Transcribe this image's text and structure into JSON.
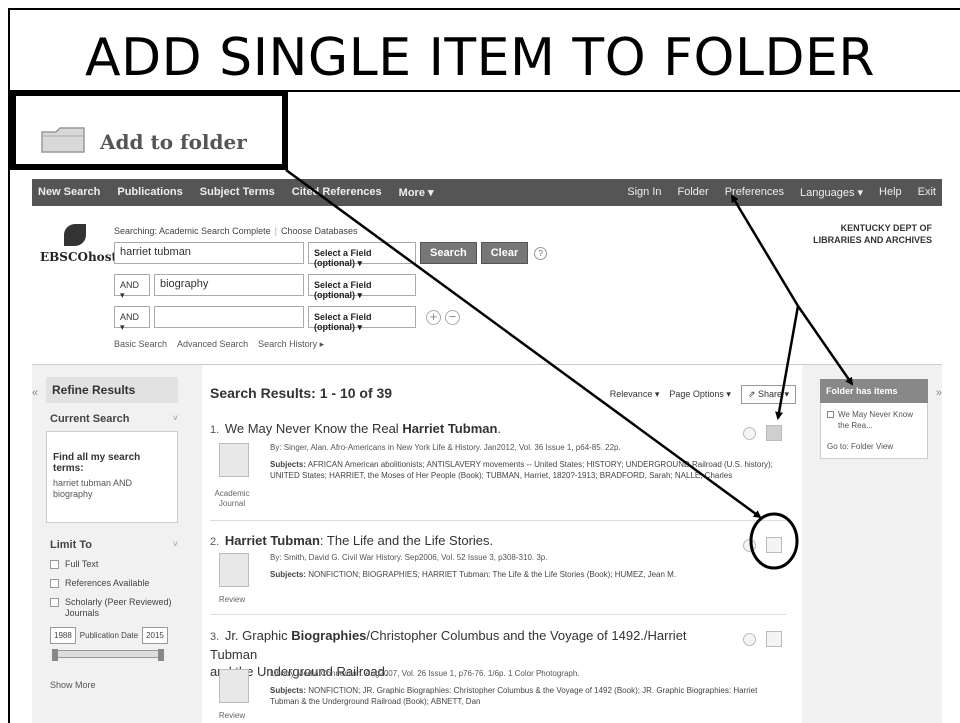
{
  "slide": {
    "title": "ADD SINGLE ITEM TO FOLDER"
  },
  "callout": {
    "label": "Add to folder",
    "icon": "folder-icon"
  },
  "topnav": {
    "left": [
      "New Search",
      "Publications",
      "Subject Terms",
      "Cited References",
      "More ▾"
    ],
    "right": [
      "Sign In",
      "Folder",
      "Preferences",
      "Languages ▾",
      "Help",
      "Exit"
    ]
  },
  "search": {
    "logo_text": "EBSCOhost",
    "searching_label": "Searching: Academic Search Complete",
    "choose_db": "Choose Databases",
    "row1": {
      "value": "harriet tubman",
      "field": "Select a Field (optional) ▾"
    },
    "row2": {
      "bool": "AND ▾",
      "value": "biography",
      "field": "Select a Field (optional) ▾"
    },
    "row3": {
      "bool": "AND ▾",
      "value": "",
      "field": "Select a Field (optional) ▾"
    },
    "search_btn": "Search",
    "clear_btn": "Clear",
    "help": "?",
    "add_row": "+",
    "remove_row": "−",
    "links": [
      "Basic Search",
      "Advanced Search",
      "Search History ▸"
    ],
    "org_line1": "KENTUCKY DEPT OF",
    "org_line2": "LIBRARIES AND ARCHIVES"
  },
  "refine": {
    "title": "Refine Results",
    "current_search": "Current Search",
    "find_all": "Find all my search terms:",
    "terms_line1": "harriet tubman AND",
    "terms_line2": "biography",
    "limit_to": "Limit To",
    "checks": [
      "Full Text",
      "References Available",
      "Scholarly (Peer Reviewed) Journals"
    ],
    "date_from": "1988",
    "date_label": "Publication Date",
    "date_to": "2015",
    "show_more": "Show More",
    "collapse_left": "«",
    "collapse_right": "»"
  },
  "results": {
    "header": "Search Results: 1 - 10 of 39",
    "sort": "Relevance ▾",
    "page_options": "Page Options ▾",
    "share": "Share ▾",
    "items": [
      {
        "num": "1.",
        "title_pre": "We May Never Know the Real ",
        "title_bold": "Harriet Tubman",
        "title_post": ".",
        "title_line2": "",
        "by": "By: Singer, Alan. Afro-Americans in New York Life & History. Jan2012, Vol. 36 Issue 1, p64-85. 22p.",
        "subjects_label": "Subjects:",
        "subjects": "AFRICAN American abolitionists; ANTISLAVERY movements -- United States; HISTORY; UNDERGROUND Railroad (U.S. history); UNITED States; HARRIET, the Moses of Her People (Book); TUBMAN, Harriet, 1820?-1913; BRADFORD, Sarah; NALLE, Charles",
        "type": "Academic Journal"
      },
      {
        "num": "2.",
        "title_pre": "",
        "title_bold": "Harriet Tubman",
        "title_post": ": The Life and the Life Stories.",
        "title_line2": "",
        "by": "By: Smith, David G. Civil War History. Sep2006, Vol. 52 Issue 3, p308-310. 3p.",
        "subjects_label": "Subjects:",
        "subjects": "NONFICTION; BIOGRAPHIES; HARRIET Tubman: The Life & the Life Stories (Book); HUMEZ, Jean M.",
        "type": "Review"
      },
      {
        "num": "3.",
        "title_pre": "Jr. Graphic ",
        "title_bold": "Biographies",
        "title_post": "/Christopher Columbus and the Voyage of 1492./Harriet Tubman",
        "title_line2": "and the Underground Railroad.",
        "by": "Library Media Connection. Aug2007, Vol. 26 Issue 1, p76-76. 1/6p. 1 Color Photograph.",
        "subjects_label": "Subjects:",
        "subjects": "NONFICTION; JR. Graphic Biographies: Christopher Columbus & the Voyage of 1492 (Book); JR. Graphic Biographies: Harriet Tubman & the Underground Railroad (Book); ABNETT, Dan",
        "type": "Review"
      }
    ]
  },
  "folder_panel": {
    "title": "Folder has items",
    "item": "We May Never Know the Rea...",
    "goto": "Go to: Folder View"
  }
}
